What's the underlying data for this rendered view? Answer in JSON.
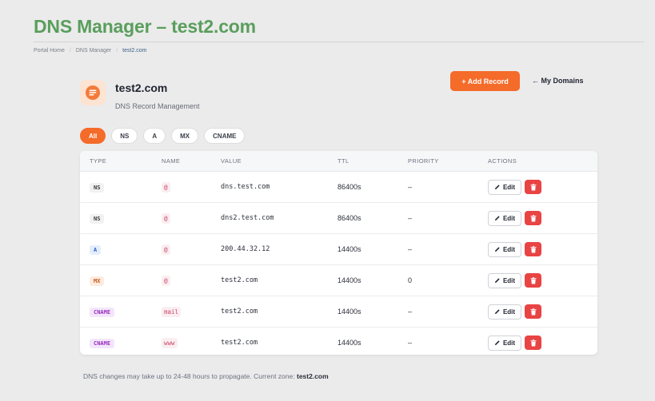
{
  "page": {
    "title": "DNS Manager – test2.com"
  },
  "breadcrumb": [
    "Portal Home",
    "DNS Manager",
    "test2.com"
  ],
  "domain": {
    "name": "test2.com",
    "subtitle": "DNS Record Management"
  },
  "buttons": {
    "add_record": "+ Add Record",
    "my_domains": "← My Domains"
  },
  "filters": [
    {
      "label": "All",
      "active": true
    },
    {
      "label": "NS",
      "active": false
    },
    {
      "label": "A",
      "active": false
    },
    {
      "label": "MX",
      "active": false
    },
    {
      "label": "CNAME",
      "active": false
    }
  ],
  "table": {
    "headers": {
      "type": "TYPE",
      "name": "NAME",
      "value": "VALUE",
      "ttl": "TTL",
      "priority": "PRIORITY",
      "actions": "ACTIONS"
    },
    "edit_label": "Edit",
    "rows": [
      {
        "type": "NS",
        "name": "@",
        "value": "dns.test.com",
        "ttl": "86400s",
        "priority": "–"
      },
      {
        "type": "NS",
        "name": "@",
        "value": "dns2.test.com",
        "ttl": "86400s",
        "priority": "–"
      },
      {
        "type": "A",
        "name": "@",
        "value": "200.44.32.12",
        "ttl": "14400s",
        "priority": "–"
      },
      {
        "type": "MX",
        "name": "@",
        "value": "test2.com",
        "ttl": "14400s",
        "priority": "0"
      },
      {
        "type": "CNAME",
        "name": "mail",
        "value": "test2.com",
        "ttl": "14400s",
        "priority": "–"
      },
      {
        "type": "CNAME",
        "name": "www",
        "value": "test2.com",
        "ttl": "14400s",
        "priority": "–"
      }
    ]
  },
  "footer": {
    "note": "DNS changes may take up to 24-48 hours to propagate. Current zone:",
    "zone": "test2.com"
  },
  "colors": {
    "accent": "#f56b2a",
    "title_green": "#5a9e5d",
    "delete_red": "#e94444"
  },
  "icons": {
    "logo": "server-icon",
    "edit": "pencil-icon",
    "delete": "trash-icon"
  }
}
